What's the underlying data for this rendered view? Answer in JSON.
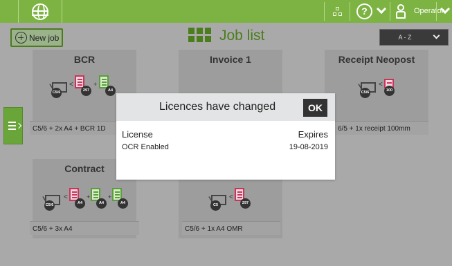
{
  "header": {
    "user_label": "Operator"
  },
  "toolbar": {
    "new_job_label": "New job",
    "page_title": "Job list",
    "sort_label": "A - Z"
  },
  "jobs": [
    {
      "name": "BCR",
      "description": "C5/6 + 2x A4 + BCR 1D",
      "envelope": "C5/6",
      "badges": [
        "297",
        "A4"
      ]
    },
    {
      "name": "Invoice 1",
      "description": "",
      "envelope": "",
      "badges": []
    },
    {
      "name": "Receipt Neopost",
      "description": "6/5 + 1x receipt 100mm",
      "envelope": "C5/6",
      "badges": [
        "100"
      ]
    },
    {
      "name": "Contract",
      "description": "C5/6 + 3x A4",
      "envelope": "C5/6",
      "badges": [
        "A4",
        "A4",
        "A4"
      ]
    },
    {
      "name": "",
      "description": "C5/6 + 1x A4 OMR",
      "envelope": "C5",
      "badges": [
        "297"
      ]
    }
  ],
  "modal": {
    "title": "Licences have changed",
    "ok_label": "OK",
    "col_license": "License",
    "col_expires": "Expires",
    "rows": [
      {
        "license": "OCR Enabled",
        "expires": "19-08-2019"
      }
    ]
  },
  "colors": {
    "topbar": "#7cb342",
    "accent_dark": "#4b7d1c",
    "overlay_bg": "#a9a9a9",
    "modal_header": "#e3e4e5"
  }
}
